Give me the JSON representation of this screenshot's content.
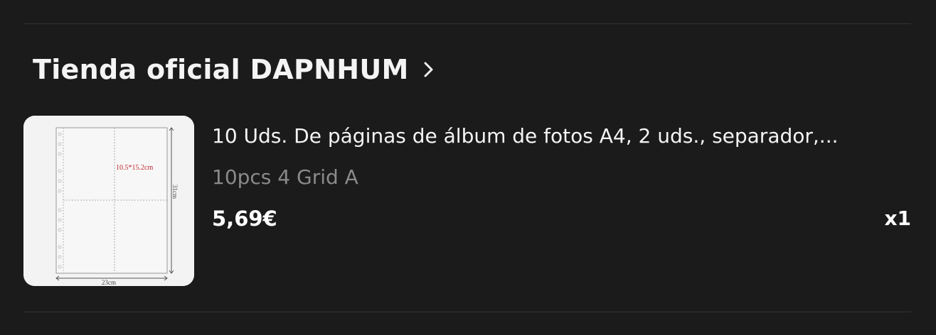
{
  "store": {
    "name": "Tienda oficial DAPNHUM"
  },
  "item": {
    "title": "10 Uds. De páginas de álbum de fotos A4, 2 uds., separador,...",
    "variant": "10pcs 4 Grid A",
    "price": "5,69€",
    "quantity": "x1",
    "image": {
      "slot_label": "10.5*15.2cm",
      "height_label": "31cm",
      "width_label": "23cm"
    }
  }
}
